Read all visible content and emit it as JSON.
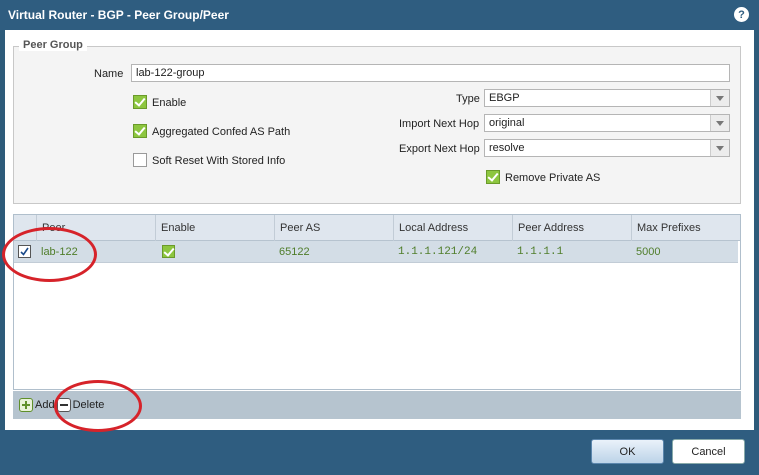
{
  "window": {
    "title": "Virtual Router - BGP - Peer Group/Peer",
    "help_icon_label": "?"
  },
  "peer_group": {
    "legend": "Peer Group",
    "name_label": "Name",
    "name_value": "lab-122-group",
    "enable_label": "Enable",
    "enable_checked": true,
    "aggregated_label": "Aggregated Confed AS Path",
    "aggregated_checked": true,
    "soft_reset_label": "Soft Reset With Stored Info",
    "soft_reset_checked": false,
    "type_label": "Type",
    "type_value": "EBGP",
    "import_label": "Import Next Hop",
    "import_value": "original",
    "export_label": "Export Next Hop",
    "export_value": "resolve",
    "remove_private_label": "Remove Private AS",
    "remove_private_checked": true
  },
  "grid": {
    "columns": [
      "Peer",
      "Enable",
      "Peer AS",
      "Local Address",
      "Peer Address",
      "Max Prefixes"
    ],
    "rows": [
      {
        "selected": true,
        "peer": "lab-122",
        "enable": true,
        "peer_as": "65122",
        "local_address": "1.1.1.121/24",
        "peer_address": "1.1.1.1",
        "max_prefixes": "5000"
      }
    ]
  },
  "toolbar": {
    "add_label": "Add",
    "delete_label": "Delete"
  },
  "footer": {
    "ok_label": "OK",
    "cancel_label": "Cancel"
  },
  "colors": {
    "title_bg": "#2f5d80",
    "annotation": "#d6232a",
    "check_green": "#8dc63f"
  }
}
